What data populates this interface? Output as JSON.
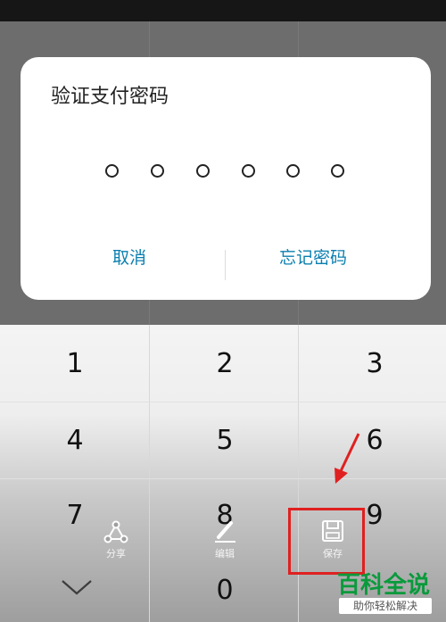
{
  "dialog": {
    "title": "验证支付密码",
    "cancel_label": "取消",
    "forgot_label": "忘记密码"
  },
  "keypad": {
    "keys": [
      "1",
      "2",
      "3",
      "4",
      "5",
      "6",
      "7",
      "8",
      "9",
      "0"
    ]
  },
  "toolbar": {
    "share_label": "分享",
    "edit_label": "编辑",
    "save_label": "保存"
  },
  "watermark": {
    "main": "百科全说",
    "sub": "助你轻松解决"
  },
  "icons": [
    "chevron-down-icon",
    "share-icon",
    "edit-icon",
    "save-icon",
    "annotation-arrow-icon"
  ],
  "colors": {
    "dialog_button": "#0b7fb0",
    "highlight": "#e02020",
    "watermark_green": "#0a9a3c"
  }
}
